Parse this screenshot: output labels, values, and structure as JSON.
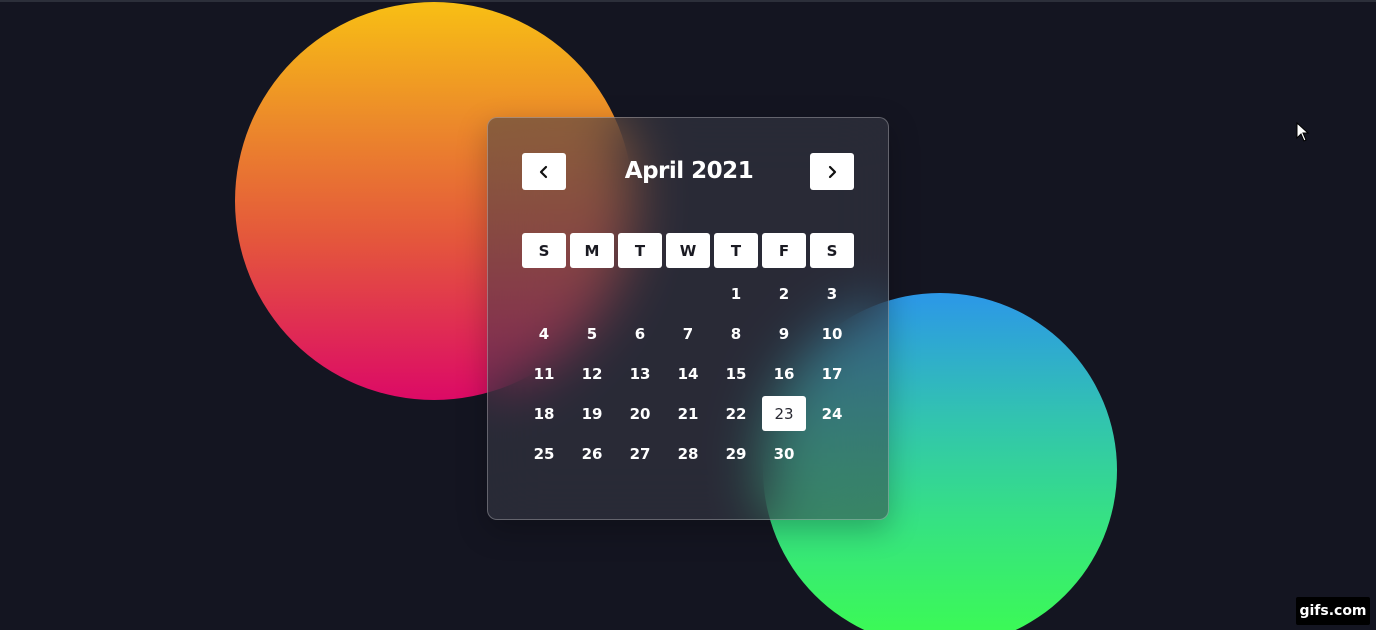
{
  "calendar": {
    "month_title": "April 2021",
    "prev_icon": "chevron-left-icon",
    "next_icon": "chevron-right-icon",
    "weekdays": [
      "S",
      "M",
      "T",
      "W",
      "T",
      "F",
      "S"
    ],
    "leading_blanks": 4,
    "days": [
      "1",
      "2",
      "3",
      "4",
      "5",
      "6",
      "7",
      "8",
      "9",
      "10",
      "11",
      "12",
      "13",
      "14",
      "15",
      "16",
      "17",
      "18",
      "19",
      "20",
      "21",
      "22",
      "23",
      "24",
      "25",
      "26",
      "27",
      "28",
      "29",
      "30"
    ],
    "selected_day": "23"
  },
  "colors": {
    "background": "#141521",
    "warm_circle": [
      "#f8bf14",
      "#dc0a66"
    ],
    "cool_circle": [
      "#2c97e8",
      "#3cfd50"
    ]
  },
  "watermark": {
    "text": "gifs.com"
  }
}
